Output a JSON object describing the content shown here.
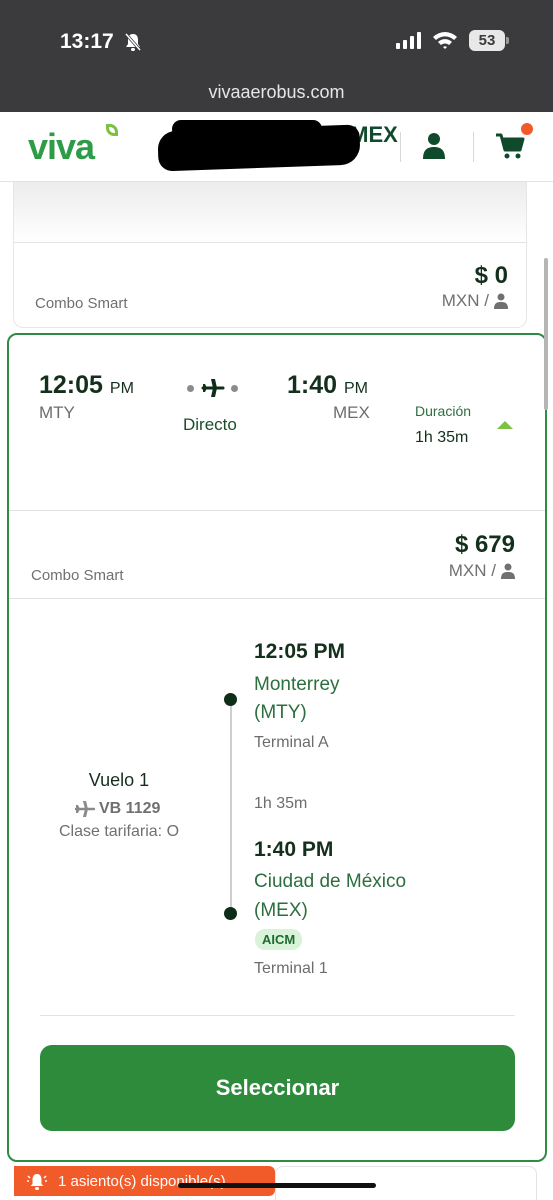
{
  "status_bar": {
    "time": "13:17",
    "battery": "53",
    "url": "vivaaerobus.com"
  },
  "header": {
    "logo": "viva",
    "route": "AICIOU - MTY - MEX",
    "icons": [
      "user-icon",
      "cart-icon"
    ]
  },
  "previous_fare": {
    "name": "Combo Smart",
    "price": "$ 0",
    "currency": "MXN /"
  },
  "flight": {
    "depart_time": "12:05",
    "depart_ampm": "PM",
    "depart_code": "MTY",
    "type": "Directo",
    "arrive_time": "1:40",
    "arrive_ampm": "PM",
    "arrive_code": "MEX",
    "duration_label": "Duración",
    "duration": "1h 35m"
  },
  "fare": {
    "name": "Combo Smart",
    "price": "$ 679",
    "currency": "MXN /"
  },
  "details": {
    "flight_label": "Vuelo 1",
    "flight_number": "VB 1129",
    "fare_class": "Clase tarifaria: O",
    "origin": {
      "time": "12:05 PM",
      "city_line1": "Monterrey",
      "city_line2": "(MTY)",
      "terminal": "Terminal A"
    },
    "segment_duration": "1h 35m",
    "destination": {
      "time": "1:40 PM",
      "city_line1": "Ciudad de México",
      "city_line2": "(MEX)",
      "badge": "AICM",
      "terminal": "Terminal 1"
    }
  },
  "select_button": "Seleccionar",
  "seat_alert": "1 asiento(s) disponible(s)",
  "colors": {
    "brand_green": "#2e8b3c",
    "logo_green": "#2e9b47",
    "accent_lime": "#7cc242",
    "alert_orange": "#f15a29"
  }
}
